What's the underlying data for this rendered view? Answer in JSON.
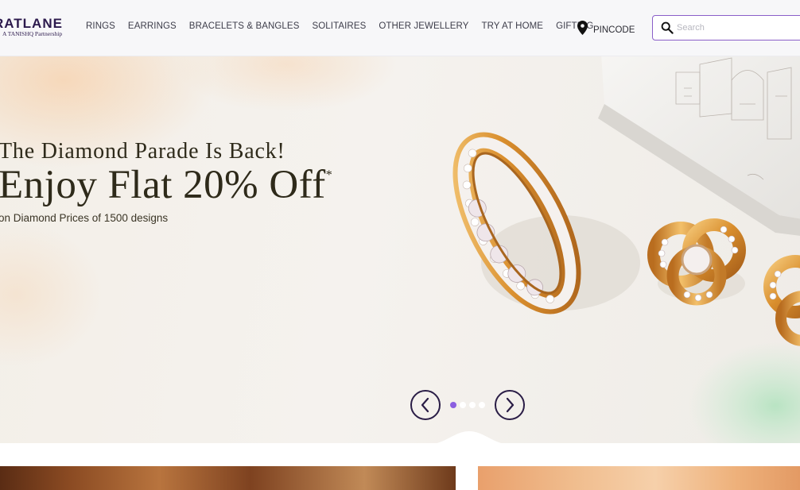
{
  "brand": {
    "name": "RATLANE",
    "tagline": "A TANISHQ Partnership"
  },
  "nav": {
    "items": [
      "RINGS",
      "EARRINGS",
      "BRACELETS & BANGLES",
      "SOLITAIRES",
      "OTHER JEWELLERY",
      "TRY AT HOME",
      "GIFTING"
    ]
  },
  "pincode": {
    "label": "PINCODE",
    "icon": "location-pin-icon"
  },
  "search": {
    "placeholder": "Search",
    "value": "",
    "icon": "search-icon"
  },
  "hero": {
    "line1": "The Diamond Parade Is Back!",
    "line2": "Enjoy Flat 20% Off",
    "line2_mark": "*",
    "line3": "on Diamond Prices of 1500 designs",
    "slides_total": 4,
    "active_slide": 1,
    "prev_icon": "chevron-left-icon",
    "next_icon": "chevron-right-icon"
  },
  "colors": {
    "brand": "#2c1a4d",
    "accent": "#8b5fe0",
    "search_border": "#8b5fc9",
    "hero_text": "#2e2a1a"
  }
}
